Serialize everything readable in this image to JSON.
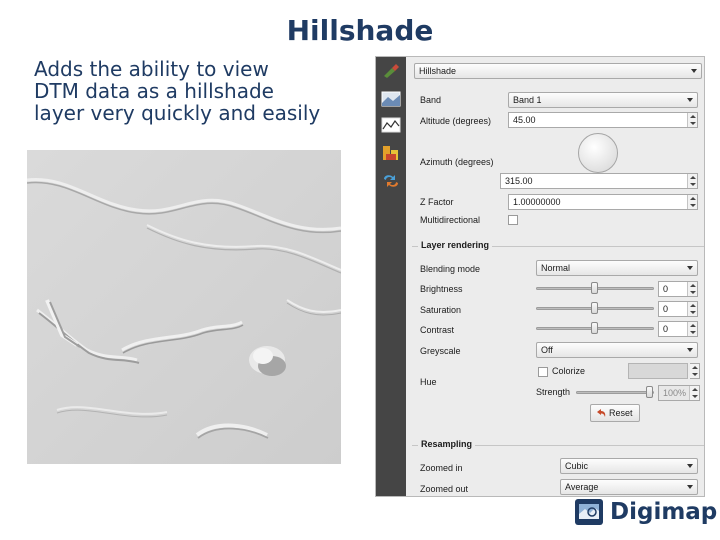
{
  "slide": {
    "title": "Hillshade",
    "body_lines": [
      "Adds the ability to view",
      "DTM data as a hillshade",
      "layer very quickly and easily"
    ]
  },
  "panel": {
    "render_type": "Hillshade",
    "band_label": "Band",
    "band_value": "Band 1",
    "altitude_label": "Altitude (degrees)",
    "altitude_value": "45.00",
    "azimuth_label": "Azimuth (degrees)",
    "azimuth_value": "315.00",
    "zfactor_label": "Z Factor",
    "zfactor_value": "1.00000000",
    "multidirectional_label": "Multidirectional",
    "layer_rendering": {
      "title": "Layer rendering",
      "blending_label": "Blending mode",
      "blending_value": "Normal",
      "brightness_label": "Brightness",
      "brightness_value": "0",
      "saturation_label": "Saturation",
      "saturation_value": "0",
      "contrast_label": "Contrast",
      "contrast_value": "0",
      "greyscale_label": "Greyscale",
      "greyscale_value": "Off",
      "colorize_label": "Colorize",
      "hue_label": "Hue",
      "strength_label": "Strength",
      "strength_value": "100%",
      "reset_label": "Reset"
    },
    "resampling": {
      "title": "Resampling",
      "zoomed_in_label": "Zoomed in",
      "zoomed_in_value": "Cubic",
      "zoomed_out_label": "Zoomed out",
      "zoomed_out_value": "Average"
    }
  },
  "logo": {
    "text": "Digimap",
    "reg": "®"
  },
  "colors": {
    "title_blue": "#1f3b63",
    "panel_bg": "#ececec",
    "toolbar_dark": "#454545"
  }
}
